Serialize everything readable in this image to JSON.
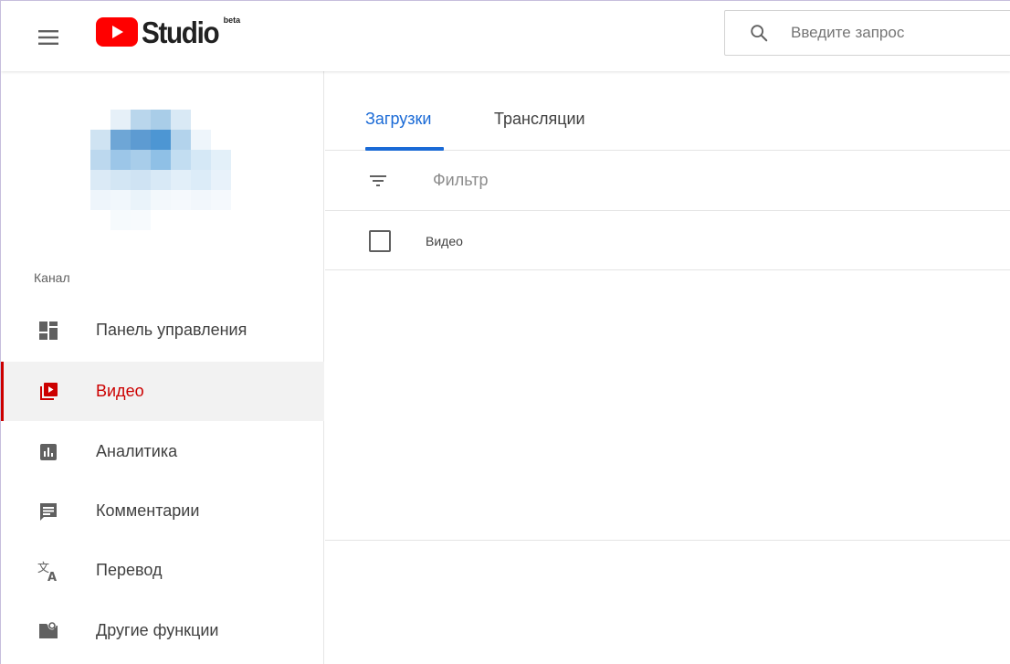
{
  "app": {
    "logo_text": "Studio",
    "logo_badge": "beta",
    "brand_color": "#ff0000"
  },
  "header": {
    "menu_icon": "hamburger-menu-icon",
    "search": {
      "icon": "search-icon",
      "placeholder": "Введите запрос",
      "value": ""
    }
  },
  "sidebar": {
    "section_label": "Канал",
    "items": [
      {
        "id": "dashboard",
        "label": "Панель управления",
        "icon": "dashboard-icon",
        "active": false
      },
      {
        "id": "video",
        "label": "Видео",
        "icon": "video-library-icon",
        "active": true
      },
      {
        "id": "analytics",
        "label": "Аналитика",
        "icon": "analytics-icon",
        "active": false
      },
      {
        "id": "comments",
        "label": "Комментарии",
        "icon": "comment-icon",
        "active": false
      },
      {
        "id": "translation",
        "label": "Перевод",
        "icon": "translate-icon",
        "active": false
      },
      {
        "id": "other",
        "label": "Другие функции",
        "icon": "other-features-icon",
        "active": false
      }
    ],
    "active_color": "#cc0000"
  },
  "main": {
    "tabs": [
      {
        "label": "Загрузки",
        "active": true
      },
      {
        "label": "Трансляции",
        "active": false
      }
    ],
    "accent_color": "#1a6ad6",
    "filter": {
      "icon": "filter-icon",
      "placeholder": "Фильтр"
    },
    "table": {
      "columns": [
        "Видео"
      ],
      "rows": []
    }
  }
}
